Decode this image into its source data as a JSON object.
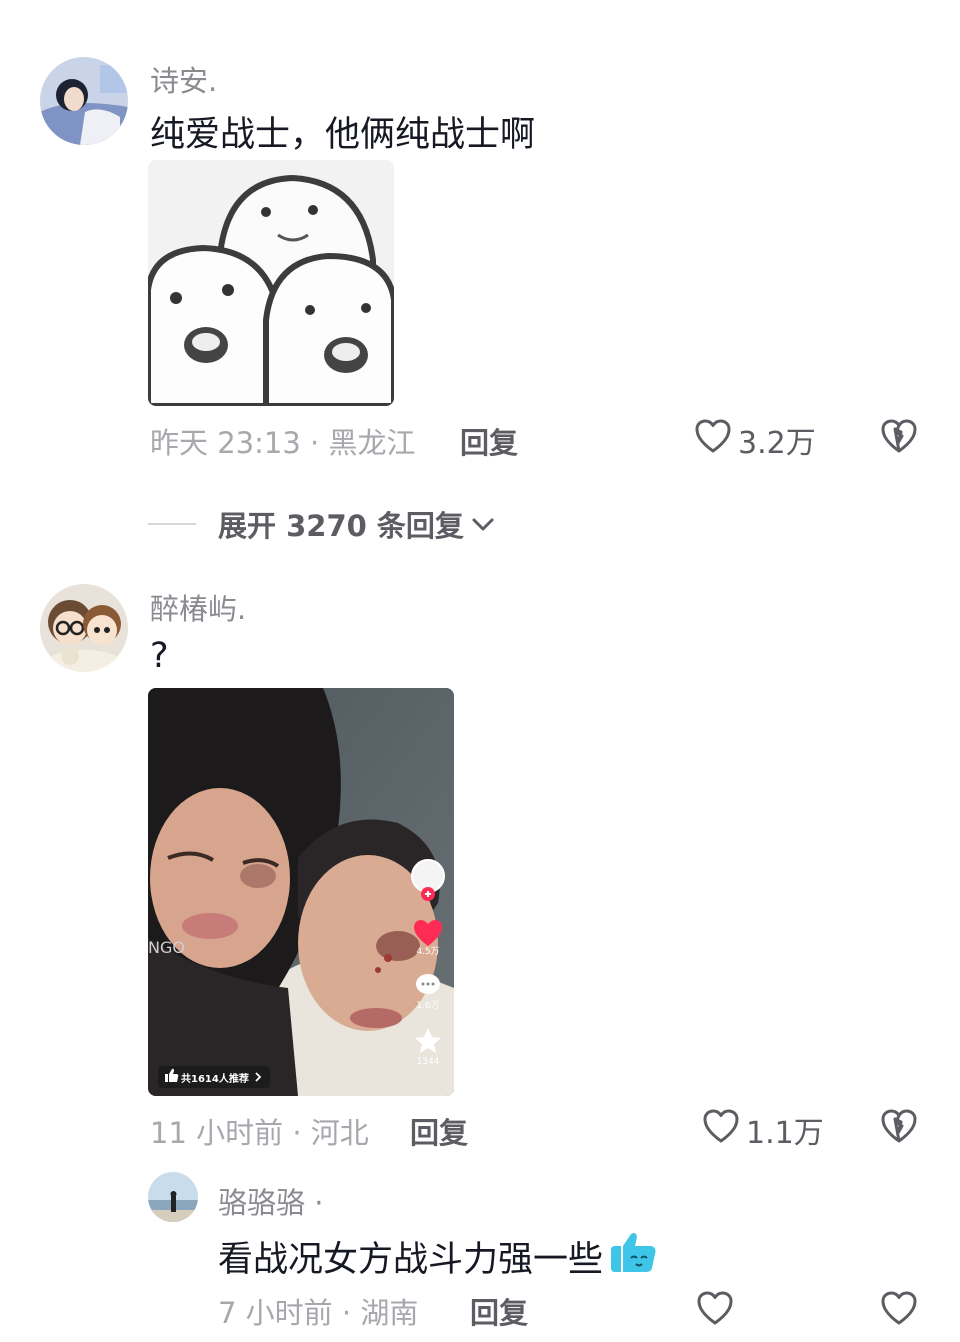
{
  "comments": [
    {
      "username": "诗安.",
      "text": "纯爱战士，他俩纯战士啊",
      "meta": "昨天 23:13 · 黑龙江",
      "reply_label": "回复",
      "likes": "3.2万",
      "expand_label": "展开 3270 条回复"
    },
    {
      "username": "醉椿屿.",
      "text": "?",
      "meta": "11 小时前 · 河北",
      "reply_label": "回复",
      "likes": "1.1万",
      "video": {
        "side_likes": "4.5万",
        "side_comments": "1.6万",
        "side_favorites": "1344",
        "recommend_badge": "共1614人推荐",
        "shirt_text": "NGO"
      }
    }
  ],
  "sub_reply": {
    "username": "骆骆骆 ·",
    "text": "看战况女方战斗力强一些",
    "meta": "7 小时前 · 湖南",
    "reply_label": "回复"
  },
  "colors": {
    "username": "#8a8b91",
    "meta": "#a7a8ad",
    "action": "#5c5d63",
    "heart_red": "#fe2c55"
  }
}
